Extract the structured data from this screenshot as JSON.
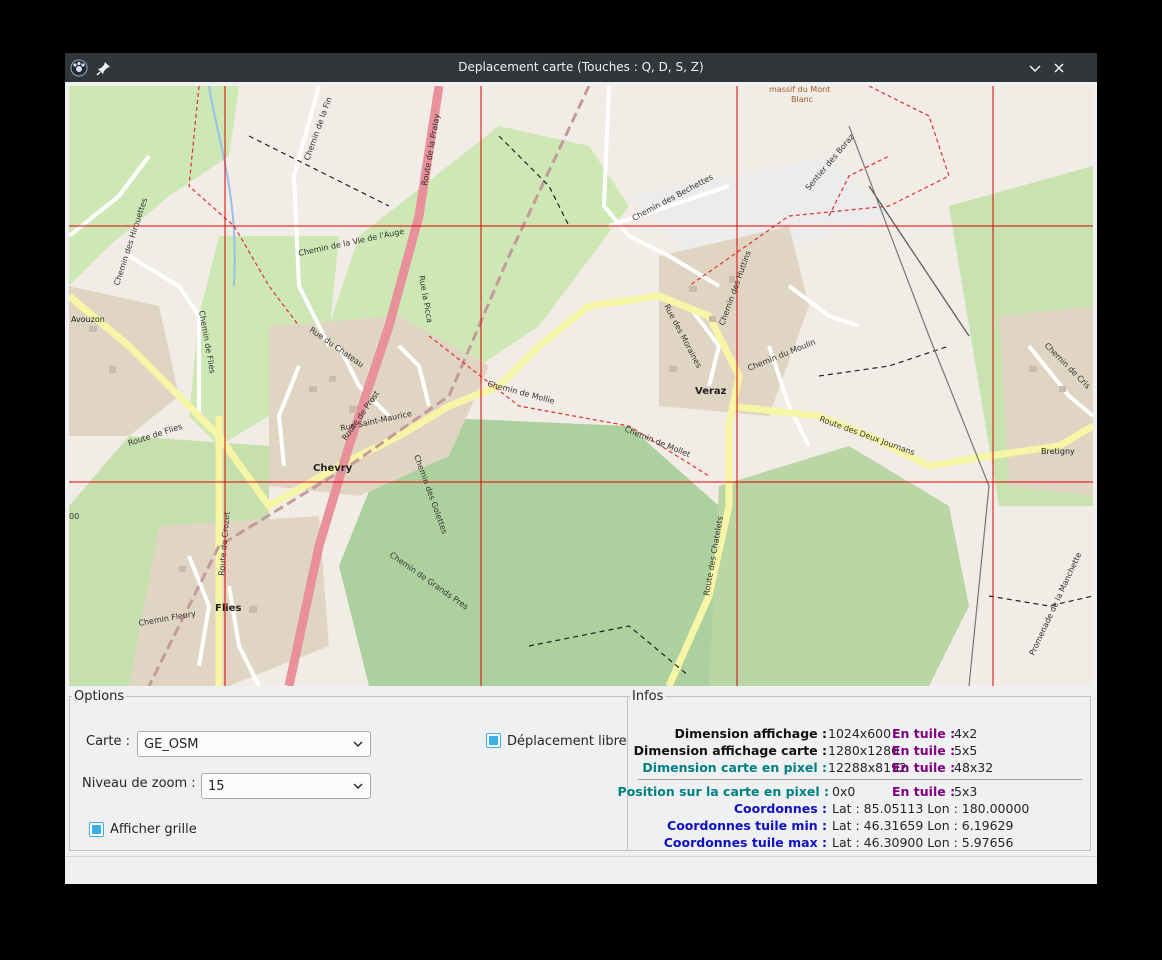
{
  "window": {
    "title": "Deplacement carte (Touches : Q, D, S, Z)"
  },
  "map": {
    "places": [
      "Chevry",
      "Veraz",
      "Flies",
      "Avouzon",
      "Bretigny",
      "massif du Mont",
      "Blanc"
    ],
    "roads": [
      "Route de la Pralay",
      "Chemin de la Fin",
      "Chemin des Hirouettes",
      "Chemin de la Vie de l'Auge",
      "Chemin des Bechettes",
      "Sentier des Boraz",
      "Chemin des Huttins",
      "Chemin du Moulin",
      "Rue des Moraines",
      "Rue du Chateau",
      "Rue Saint-Maurice",
      "Route de Prost",
      "Chemin de Mollet",
      "Route des Deux Journans",
      "Route de Flies",
      "Chemin de Flies",
      "Rue la Picca",
      "Route du Crozet",
      "Chemin Fleury",
      "Chemin des Golettes",
      "Chemin de Grands Pres",
      "Route des Chatelets",
      "Chemin de Mollie",
      "Promenade de la Manchette",
      "Chemin de Cris"
    ],
    "edge_label": "00",
    "grid_visible": true,
    "grid_color": "#e00000"
  },
  "options": {
    "legend": "Options",
    "carte_label": "Carte :",
    "carte_value": "GE_OSM",
    "zoom_label": "Niveau de zoom :",
    "zoom_value": "15",
    "grid_label": "Afficher grille",
    "grid_checked": true,
    "free_move_label": "Déplacement libre",
    "free_move_checked": true
  },
  "infos": {
    "legend": "Infos",
    "rows": [
      {
        "key": "Dimension affichage :",
        "value": "1024x600",
        "tile_key": "En tuile :",
        "tile_value": "4x2"
      },
      {
        "key": "Dimension affichage carte :",
        "value": "1280x1280",
        "tile_key": "En tuile :",
        "tile_value": "5x5"
      },
      {
        "key": "Dimension carte en pixel :",
        "value": "12288x8192",
        "tile_key": "En tuile :",
        "tile_value": "48x32"
      }
    ],
    "position": {
      "key": "Position sur la carte en pixel :",
      "value": "0x0",
      "tile_key": "En tuile :",
      "tile_value": "5x3"
    },
    "coords": [
      {
        "key": "Coordonnes :",
        "value": "Lat : 85.05113 Lon : 180.00000"
      },
      {
        "key": "Coordonnes  tuile min :",
        "value": "Lat : 46.31659 Lon : 6.19629"
      },
      {
        "key": "Coordonnes  tuile max :",
        "value": "Lat : 46.30900 Lon : 5.97656"
      }
    ]
  },
  "colors": {
    "titlebar": "#31363b",
    "accent": "#3daee9",
    "info_black": "#111111",
    "info_teal": "#008080",
    "info_purple": "#800080",
    "info_blue": "#1010c0"
  }
}
